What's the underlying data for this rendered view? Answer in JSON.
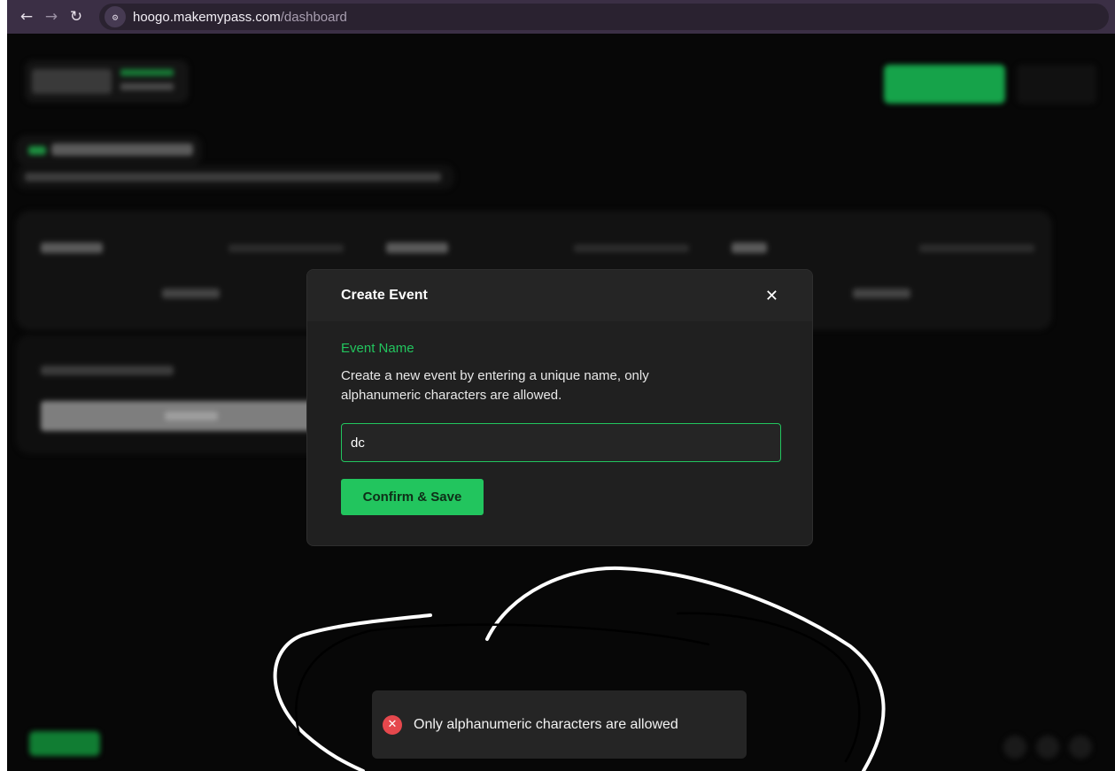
{
  "browser": {
    "url_host": "hoogo.makemypass.com",
    "url_path": "/dashboard",
    "back_icon": "arrow-left-icon",
    "forward_icon": "arrow-right-icon",
    "reload_icon": "reload-icon",
    "site_info_icon": "site-settings-icon"
  },
  "modal": {
    "title": "Create Event",
    "close_icon": "close-icon",
    "field_label": "Event Name",
    "description": "Create a new event by entering a unique name, only alphanumeric characters are allowed.",
    "input_value": "dc",
    "confirm_label": "Confirm & Save"
  },
  "toast": {
    "icon": "error-icon",
    "message": "Only alphanumeric characters are allowed"
  },
  "colors": {
    "accent": "#22c55e",
    "error": "#e5484d",
    "modal_bg": "#202020",
    "page_bg": "#070707",
    "browser_bar": "#3b2f45"
  }
}
